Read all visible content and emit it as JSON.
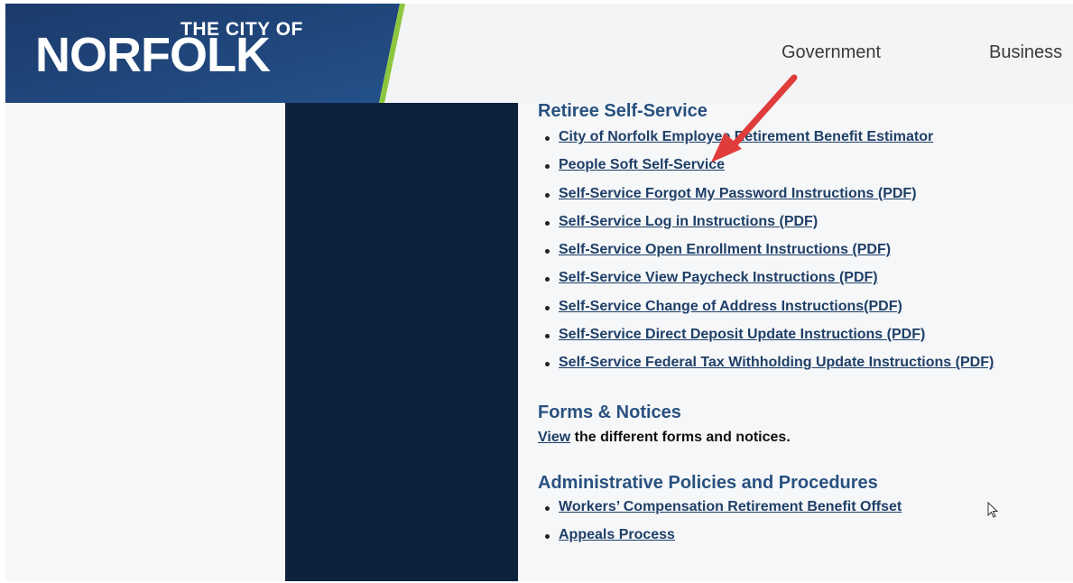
{
  "header": {
    "logo_small": "THE CITY OF",
    "logo_big": "NORFOLK",
    "nav": {
      "government": "Government",
      "business": "Business"
    }
  },
  "colors": {
    "brand_navy": "#1d4378",
    "accent_green": "#8cc63f",
    "sidebar_dark": "#0e2240",
    "heading_blue": "#285180",
    "link_blue": "#1f3f68",
    "annotation_red": "#e03c3c"
  },
  "retiree": {
    "title": "Retiree Self-Service",
    "links": [
      "City of Norfolk Employee Retirement Benefit Estimator",
      "People Soft Self-Service",
      "Self-Service Forgot My Password Instructions (PDF)",
      "Self-Service Log in Instructions (PDF)",
      "Self-Service Open Enrollment Instructions (PDF)",
      "Self-Service View Paycheck Instructions (PDF)",
      "Self-Service Change of Address Instructions(PDF)",
      "Self-Service Direct Deposit Update Instructions (PDF)",
      "Self-Service Federal Tax Withholding Update Instructions (PDF)"
    ]
  },
  "forms": {
    "title": "Forms & Notices",
    "view_link": "View",
    "text": " the different forms and notices."
  },
  "policies": {
    "title": "Administrative Policies and Procedures",
    "links": [
      "Workers’ Compensation Retirement Benefit Offset",
      "Appeals Process"
    ]
  },
  "icons": {
    "annotation": "red-arrow-icon",
    "cursor": "mouse-pointer-icon"
  }
}
